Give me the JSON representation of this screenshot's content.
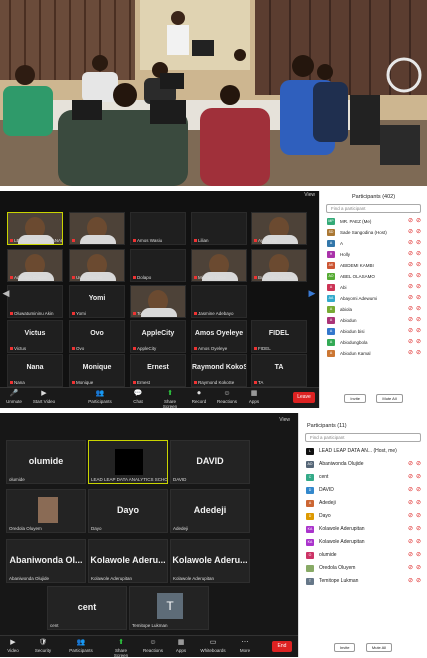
{
  "photo": {
    "caption": ""
  },
  "meeting1": {
    "view_label": "View",
    "participants_title": "Participants (402)",
    "search_placeholder": "Find a participant",
    "tiles": [
      {
        "name": "",
        "label": "LEAD LEAP DATA ANALY",
        "video": true
      },
      {
        "name": "",
        "label": "",
        "video": true
      },
      {
        "name": "",
        "label": "Amos Wasiu",
        "video": false
      },
      {
        "name": "",
        "label": "Lilian",
        "video": false
      },
      {
        "name": "",
        "label": "Ayo Nnaji",
        "video": true
      },
      {
        "name": "",
        "label": "Adenayo Olajide",
        "video": true
      },
      {
        "name": "",
        "label": "Uwe Olawale",
        "video": true
      },
      {
        "name": "",
        "label": "Dolapo",
        "video": false
      },
      {
        "name": "",
        "label": "Michael Ugbo",
        "video": true
      },
      {
        "name": "",
        "label": "Busolami Akinwade",
        "video": true
      },
      {
        "name": "",
        "label": "Oluwatumininu Akin",
        "video": false
      },
      {
        "name": "Yomi",
        "label": "Yomi",
        "video": false
      },
      {
        "name": "",
        "label": "Tolu",
        "video": true
      },
      {
        "name": "",
        "label": "Jasmine Adebayo",
        "video": false
      },
      {
        "name": "Victus",
        "label": "Victus",
        "video": false
      },
      {
        "name": "Ovo",
        "label": "Ovo",
        "video": false
      },
      {
        "name": "AppleCity",
        "label": "AppleCity",
        "video": false
      },
      {
        "name": "Amos Oyeleye",
        "label": "Amos Oyeleye",
        "video": false
      },
      {
        "name": "FIDEL",
        "label": "FIDEL",
        "video": false
      },
      {
        "name": "Nana",
        "label": "Nana",
        "video": false
      },
      {
        "name": "Monique",
        "label": "Monique",
        "video": false
      },
      {
        "name": "Ernest",
        "label": "Ernest",
        "video": false
      },
      {
        "name": "Raymond KokoSe",
        "label": "Raymond KokoSe",
        "video": false
      },
      {
        "name": "TA",
        "label": "TA",
        "video": false
      }
    ],
    "toolbar": [
      {
        "label": "Unmute",
        "icon": "mic-icon"
      },
      {
        "label": "Start Video",
        "icon": "video-icon"
      },
      {
        "label": "Participants",
        "icon": "participants-icon"
      },
      {
        "label": "Chat",
        "icon": "chat-icon"
      },
      {
        "label": "Share Screen",
        "icon": "share-icon"
      },
      {
        "label": "Record",
        "icon": "record-icon"
      },
      {
        "label": "Reactions",
        "icon": "reaction-icon"
      },
      {
        "label": "Apps",
        "icon": "apps-icon"
      }
    ],
    "leave_label": "Leave",
    "participants": [
      {
        "initials": "MP",
        "name": "MR. PAEZ (Me)",
        "color": "#3a7"
      },
      {
        "initials": "SD",
        "name": "Sade Sangodina (Host)",
        "color": "#a73"
      },
      {
        "initials": "A",
        "name": "A",
        "color": "#37a"
      },
      {
        "initials": "H",
        "name": "Holly",
        "color": "#a3a"
      },
      {
        "initials": "AK",
        "name": "ABIDEMI KAMBI",
        "color": "#c53"
      },
      {
        "initials": "AO",
        "name": "ABEL OLASAMO",
        "color": "#5a3"
      },
      {
        "initials": "A",
        "name": "Abi",
        "color": "#c35"
      },
      {
        "initials": "AA",
        "name": "Abayomi Adewumi",
        "color": "#3ac"
      },
      {
        "initials": "A",
        "name": "abiola",
        "color": "#7a3"
      },
      {
        "initials": "A",
        "name": "Abiodun",
        "color": "#a37"
      },
      {
        "initials": "A",
        "name": "Abiodun bisi",
        "color": "#37c"
      },
      {
        "initials": "A",
        "name": "Abiodungbola",
        "color": "#3a5"
      },
      {
        "initials": "A",
        "name": "Abiodun Kamal",
        "color": "#c73"
      }
    ],
    "invite_label": "Invite",
    "mute_all_label": "Mute All"
  },
  "meeting2": {
    "view_label": "View",
    "participants_title": "Participants (11)",
    "search_placeholder": "Find a participant",
    "tiles": [
      {
        "name": "olumide",
        "label": "olumide",
        "type": "name"
      },
      {
        "name": "",
        "label": "LEAD LEAP DATA ANALYTICS SCHOOL",
        "type": "logo"
      },
      {
        "name": "DAVID",
        "label": "DAVID",
        "type": "name"
      },
      {
        "name": "",
        "label": "Oredola Oluyem",
        "type": "avatar"
      },
      {
        "name": "Dayo",
        "label": "Dayo",
        "type": "name"
      },
      {
        "name": "Adedeji",
        "label": "Adedeji",
        "type": "name"
      },
      {
        "name": "Abaniwonda Ol...",
        "label": "Abaniwonda Olujide",
        "type": "name"
      },
      {
        "name": "Kolawole Aderu...",
        "label": "Kolawole Aderupitan",
        "type": "name"
      },
      {
        "name": "Kolawole Aderu...",
        "label": "Kolawole Aderupitan",
        "type": "name"
      },
      {
        "name": "cent",
        "label": "cent",
        "type": "name"
      },
      {
        "name": "",
        "label": "Temitope Lukman",
        "type": "initial",
        "initial": "T"
      }
    ],
    "toolbar": [
      {
        "label": "Video",
        "icon": "video-icon"
      },
      {
        "label": "Security",
        "icon": "security-icon"
      },
      {
        "label": "Participants",
        "icon": "participants-icon"
      },
      {
        "label": "Share Screen",
        "icon": "share-icon"
      },
      {
        "label": "Reactions",
        "icon": "reaction-icon"
      },
      {
        "label": "Apps",
        "icon": "apps-icon"
      },
      {
        "label": "Whiteboards",
        "icon": "whiteboard-icon"
      },
      {
        "label": "More",
        "icon": "more-icon"
      }
    ],
    "end_label": "End",
    "participants": [
      {
        "initials": "L",
        "name": "LEAD LEAP DATA AN... (Host, me)",
        "color": "#111"
      },
      {
        "initials": "AO",
        "name": "Abaniwonda Olujide",
        "color": "#567"
      },
      {
        "initials": "C",
        "name": "cent",
        "color": "#3a8"
      },
      {
        "initials": "D",
        "name": "DAVID",
        "color": "#38c"
      },
      {
        "initials": "A",
        "name": "Adedeji",
        "color": "#c63"
      },
      {
        "initials": "D",
        "name": "Dayo",
        "color": "#d90"
      },
      {
        "initials": "KA",
        "name": "Kolawole Aderupitan",
        "color": "#a3c"
      },
      {
        "initials": "KA",
        "name": "Kolawole Aderupitan",
        "color": "#a3c"
      },
      {
        "initials": "O",
        "name": "olumide",
        "color": "#c36"
      },
      {
        "initials": "",
        "name": "Oredola Oluyem",
        "color": "#8a6"
      },
      {
        "initials": "T",
        "name": "Temitope Lukman",
        "color": "#678"
      }
    ],
    "invite_label": "Invite",
    "mute_all_label": "Mute All"
  }
}
